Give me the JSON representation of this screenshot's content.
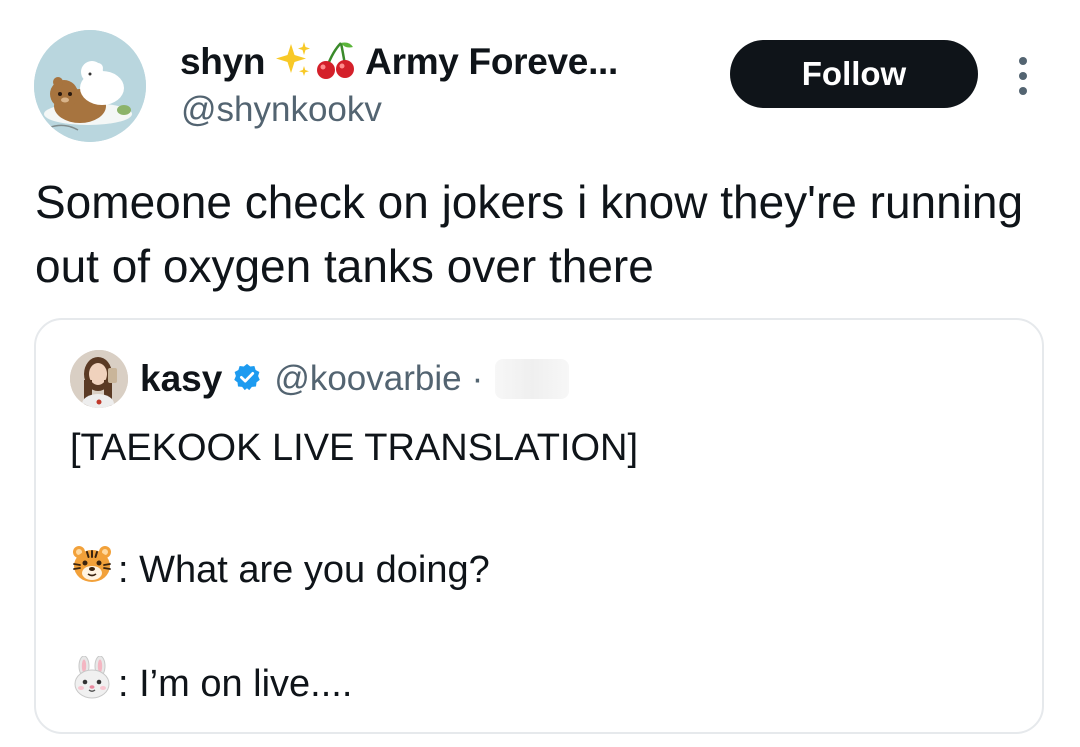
{
  "author": {
    "display_name": "shyn",
    "display_name_suffix": "Army Foreve...",
    "handle": "@shynkookv",
    "name_emojis": [
      "sparkles-emoji",
      "cherries-emoji"
    ]
  },
  "actions": {
    "follow_label": "Follow",
    "more_icon": "more-vertical-icon"
  },
  "tweet": {
    "text": "Someone check on jokers i know they're running out of oxygen tanks over there"
  },
  "quoted": {
    "display_name": "kasy",
    "verified": true,
    "handle": "@koovarbie",
    "separator": "·",
    "heading": "[TAEKOOK LIVE TRANSLATION]",
    "lines": [
      {
        "icon": "tiger-face-emoji",
        "text": ": What are you doing?"
      },
      {
        "icon": "rabbit-face-emoji",
        "text": ": I’m on live...."
      }
    ]
  },
  "colors": {
    "text": "#0f1419",
    "secondary": "#536471",
    "button_bg": "#0f1419",
    "verified": "#1d9bf0",
    "border": "#e6e9ec"
  }
}
